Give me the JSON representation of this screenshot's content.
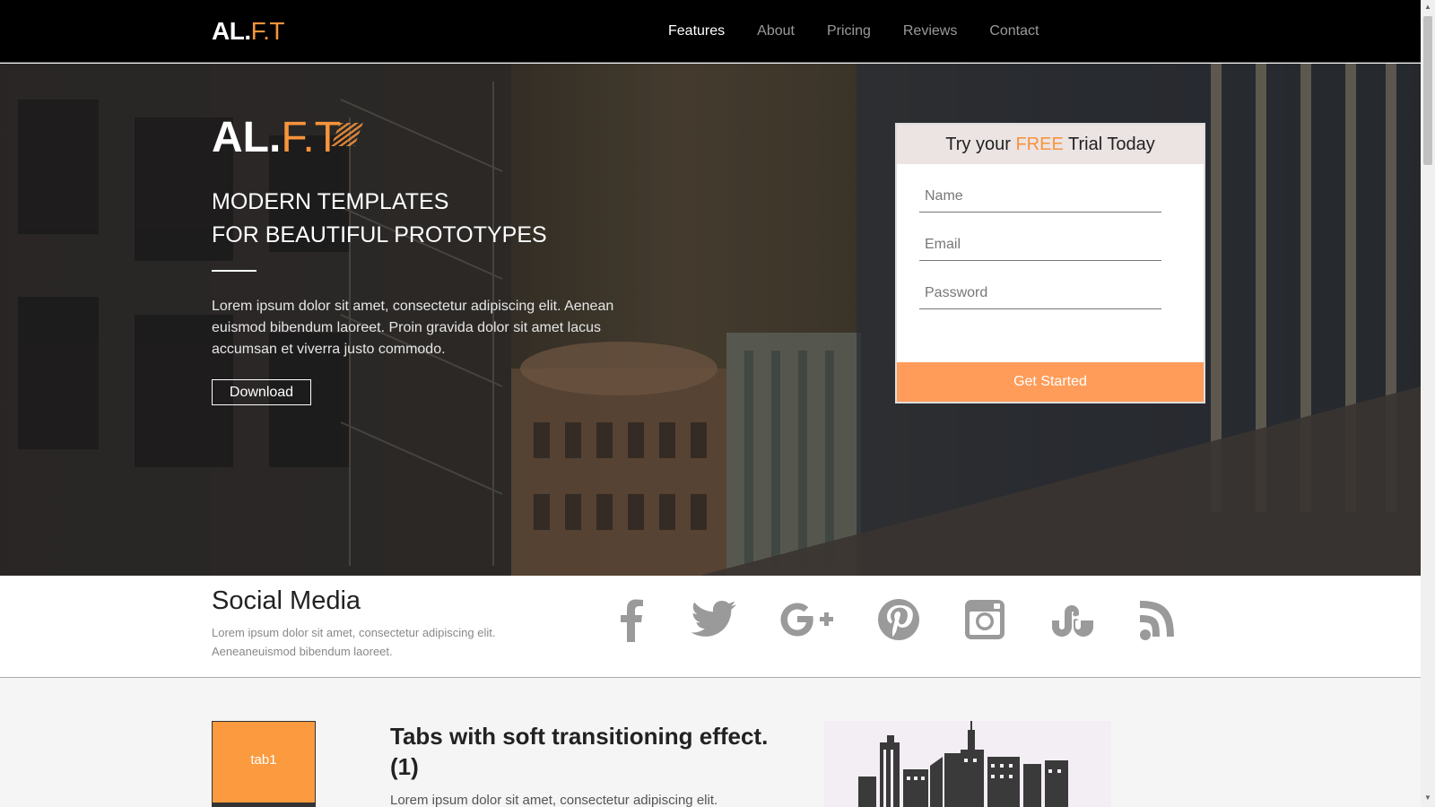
{
  "nav": {
    "brand_main": "AL.",
    "brand_accent": "F.T",
    "links": [
      "Features",
      "About",
      "Pricing",
      "Reviews",
      "Contact"
    ],
    "active": "Features"
  },
  "hero": {
    "logo_main": "AL.",
    "logo_accent": "F.T",
    "headline_1": "MODERN TEMPLATES",
    "headline_2": "FOR BEAUTIFUL PROTOTYPES",
    "text": "Lorem ipsum dolor sit amet, consectetur adipiscing elit. Aenean euismod bibendum laoreet. Proin gravida dolor sit amet lacus accumsan et viverra justo commodo.",
    "download_label": "Download"
  },
  "trial": {
    "title_pre": "Try your ",
    "title_free": "FREE",
    "title_post": " Trial Today",
    "name_placeholder": "Name",
    "email_placeholder": "Email",
    "password_placeholder": "Password",
    "cta_label": "Get Started"
  },
  "social": {
    "title": "Social Media",
    "text_line1": "Lorem ipsum dolor sit amet, consectetur adipiscing elit.",
    "text_line2": "Aeneaneuismod bibendum laoreet.",
    "icons": [
      "facebook-icon",
      "twitter-icon",
      "google-plus-icon",
      "pinterest-icon",
      "instagram-icon",
      "stumbleupon-icon",
      "rss-icon"
    ]
  },
  "tabs": {
    "tab1_label": "tab1",
    "title": "Tabs with soft transitioning effect. (1)",
    "text": "Lorem ipsum dolor sit amet, consectetur adipiscing elit."
  },
  "colors": {
    "accent": "#f7943c",
    "cta": "#ff9c5a",
    "nav_bg": "#000000"
  }
}
